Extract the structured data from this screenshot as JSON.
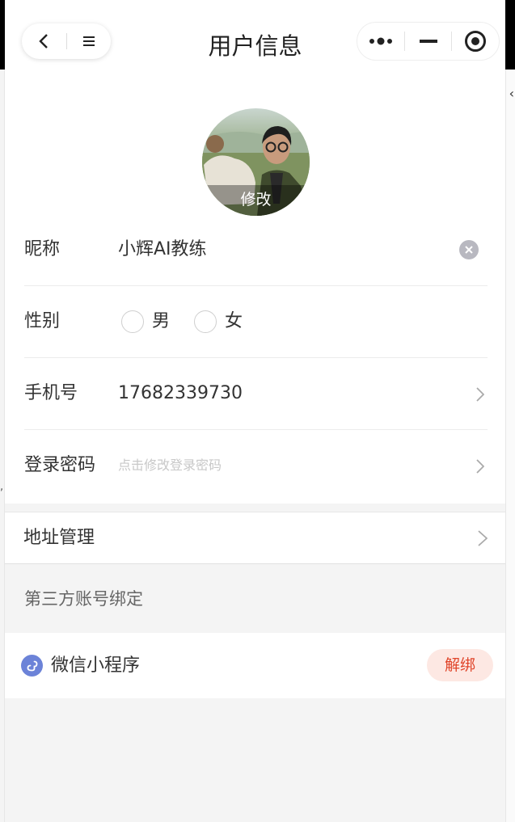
{
  "navbar": {
    "title": "用户信息",
    "icons": [
      "back-arrow-icon",
      "menu-icon",
      "more-dots-icon",
      "minimize-icon",
      "close-target-icon"
    ]
  },
  "avatar": {
    "edit_label": "修改"
  },
  "form": {
    "nickname": {
      "label": "昵称",
      "value": "小辉AI教练"
    },
    "gender": {
      "label": "性别",
      "options": [
        "男",
        "女"
      ]
    },
    "phone": {
      "label": "手机号",
      "value": "17682339730"
    },
    "password": {
      "label": "登录密码",
      "placeholder": "点击修改登录密码"
    }
  },
  "address": {
    "label": "地址管理"
  },
  "third_party": {
    "section_title": "第三方账号绑定",
    "wechat": {
      "label": "微信小程序",
      "button": "解绑"
    }
  },
  "colors": {
    "unbind_text": "#e0452a",
    "unbind_bg": "#fde8e3",
    "wechat_icon": "#6c83d8",
    "page_bg": "#f4f4f4"
  }
}
